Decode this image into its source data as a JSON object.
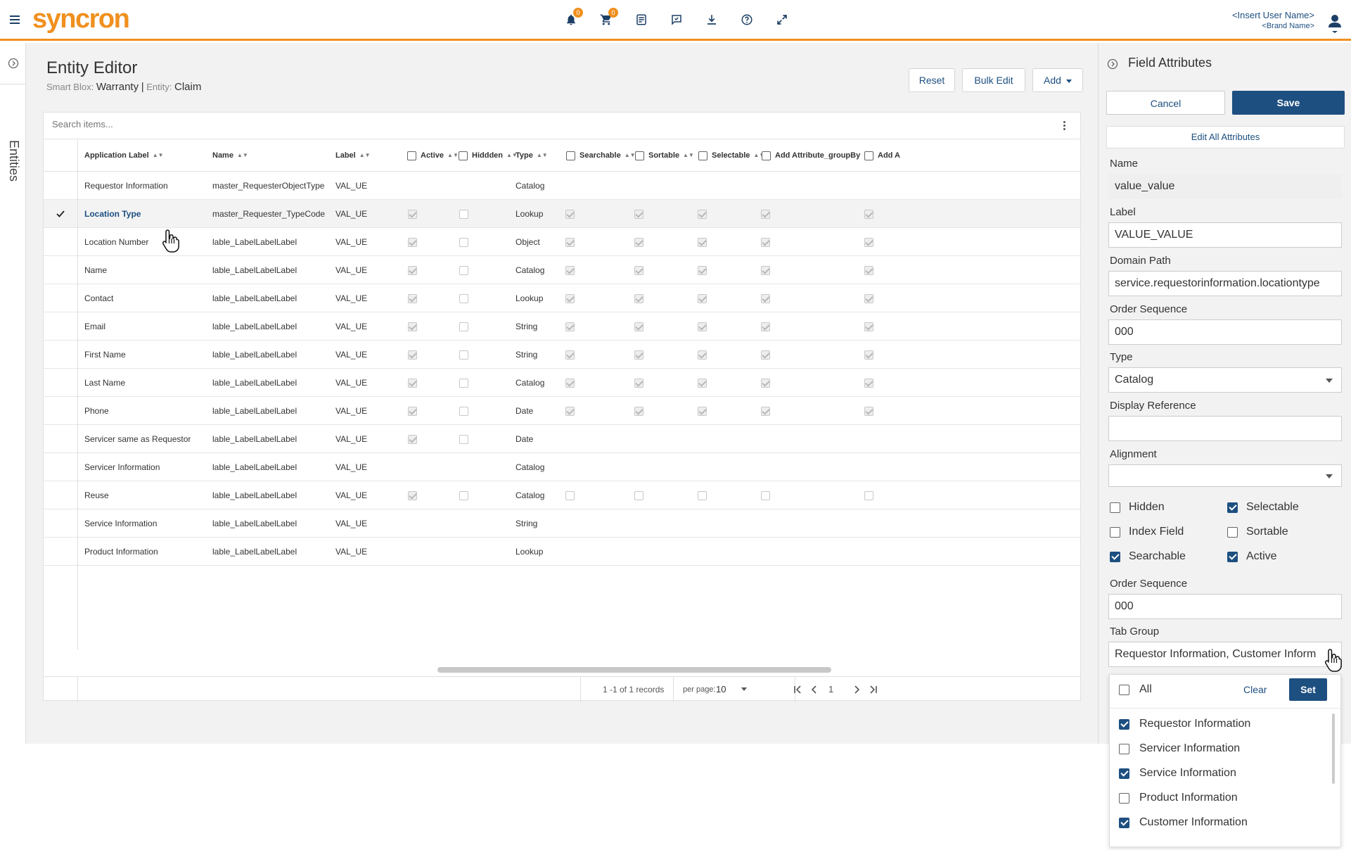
{
  "topbar": {
    "logo": "syncron",
    "notifications_count": "0",
    "cart_count": "0",
    "user_name": "<Insert User Name>",
    "brand_name": "<Brand Name>"
  },
  "left_rail": {
    "label": "Entities"
  },
  "editor": {
    "title": "Entity Editor",
    "smart_blox_label": "Smart Blox:",
    "smart_blox_value": "Warranty",
    "separator": "|",
    "entity_label": "Entity:",
    "entity_value": "Claim",
    "reset_label": "Reset",
    "bulk_edit_label": "Bulk Edit",
    "add_label": "Add",
    "search_placeholder": "Search items..."
  },
  "table": {
    "headers": {
      "application_label": "Application Label",
      "name": "Name",
      "label": "Label",
      "active": "Active",
      "hidden": "Hiddden",
      "type": "Type",
      "searchable": "Searchable",
      "sortable": "Sortable",
      "selectable": "Selectable",
      "group_by": "Add Attribute_groupBy",
      "add_a": "Add A"
    },
    "rows": [
      {
        "app_label": "Requestor Information",
        "name": "master_RequesterObjectType",
        "label": "VAL_UE",
        "type": "Catalog"
      },
      {
        "app_label": "Location Type",
        "name": "master_Requester_TypeCode",
        "label": "VAL_UE",
        "type": "Lookup"
      },
      {
        "app_label": "Location Number",
        "name": "lable_LabelLabelLabel",
        "label": "VAL_UE",
        "type": "Object"
      },
      {
        "app_label": "Name",
        "name": "lable_LabelLabelLabel",
        "label": "VAL_UE",
        "type": "Catalog"
      },
      {
        "app_label": "Contact",
        "name": "lable_LabelLabelLabel",
        "label": "VAL_UE",
        "type": "Lookup"
      },
      {
        "app_label": "Email",
        "name": "lable_LabelLabelLabel",
        "label": "VAL_UE",
        "type": "String"
      },
      {
        "app_label": "First Name",
        "name": "lable_LabelLabelLabel",
        "label": "VAL_UE",
        "type": "String"
      },
      {
        "app_label": "Last Name",
        "name": "lable_LabelLabelLabel",
        "label": "VAL_UE",
        "type": "Catalog"
      },
      {
        "app_label": "Phone",
        "name": "lable_LabelLabelLabel",
        "label": "VAL_UE",
        "type": "Date"
      },
      {
        "app_label": "Servicer same as Requestor",
        "name": "lable_LabelLabelLabel",
        "label": "VAL_UE",
        "type": "Date"
      },
      {
        "app_label": "Servicer Information",
        "name": "lable_LabelLabelLabel",
        "label": "VAL_UE",
        "type": "Catalog"
      },
      {
        "app_label": "Reuse",
        "name": "lable_LabelLabelLabel",
        "label": "VAL_UE",
        "type": "Catalog"
      },
      {
        "app_label": "Service Information",
        "name": "lable_LabelLabelLabel",
        "label": "VAL_UE",
        "type": "String"
      },
      {
        "app_label": "Product Information",
        "name": "lable_LabelLabelLabel",
        "label": "VAL_UE",
        "type": "Lookup"
      }
    ],
    "pager": {
      "records": "1 -1 of 1 records",
      "per_page_label": "per page:",
      "per_page_value": "10",
      "page": "1"
    }
  },
  "field_attributes": {
    "title": "Field Attributes",
    "cancel_label": "Cancel",
    "save_label": "Save",
    "edit_all_label": "Edit All Attributes",
    "name_label": "Name",
    "name_value": "value_value",
    "label_label": "Label",
    "label_value": "VALUE_VALUE",
    "domain_path_label": "Domain Path",
    "domain_path_value": "service.requestorinformation.locationtype",
    "order_sequence_label": "Order Sequence",
    "order_sequence_value": "000",
    "type_label": "Type",
    "type_value": "Catalog",
    "display_reference_label": "Display Reference",
    "display_reference_value": "",
    "alignment_label": "Alignment",
    "alignment_value": "",
    "checkboxes": {
      "hidden": "Hidden",
      "selectable": "Selectable",
      "index_field": "Index Field",
      "sortable": "Sortable",
      "searchable": "Searchable",
      "active": "Active"
    },
    "order_sequence2_label": "Order Sequence",
    "order_sequence2_value": "000",
    "tab_group_label": "Tab Group",
    "tab_group_value": "Requestor Information, Customer Inform"
  },
  "tab_group_dropdown": {
    "all_label": "All",
    "clear_label": "Clear",
    "set_label": "Set",
    "options": [
      {
        "label": "Requestor Information",
        "checked": true
      },
      {
        "label": "Servicer Information",
        "checked": false
      },
      {
        "label": "Service Information",
        "checked": true
      },
      {
        "label": "Product Information",
        "checked": false
      },
      {
        "label": "Customer Information",
        "checked": true
      }
    ]
  },
  "colors": {
    "brand": "#f0901e",
    "primary": "#1d4f80"
  }
}
